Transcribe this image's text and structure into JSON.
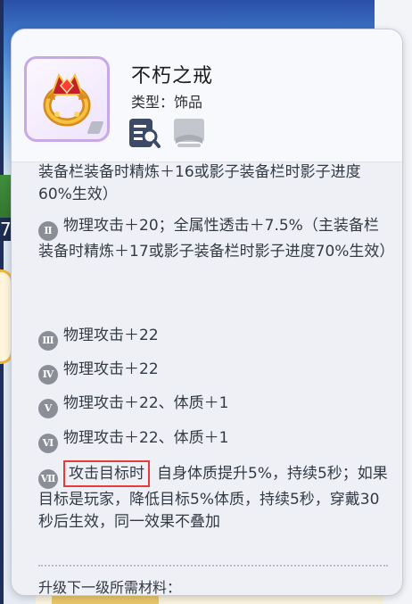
{
  "item": {
    "name": "不朽之戒",
    "type_label": "类型：饰品",
    "rarity_color": "#c7a9e8"
  },
  "actions": {
    "inspect_icon": "inspect-list-icon",
    "book_icon": "book-icon"
  },
  "attributes": [
    {
      "text": "装备栏装备时精炼＋16或影子装备栏时影子进度60%生效）"
    },
    {
      "numeral": "Ⅱ",
      "text": "物理攻击＋20；全属性透击＋7.5%（主装备栏装备时精炼＋17或影子装备栏时影子进度70%生效）"
    },
    {
      "numeral": "Ⅲ",
      "text": "物理攻击＋22"
    },
    {
      "numeral": "Ⅳ",
      "text": "物理攻击＋22"
    },
    {
      "numeral": "Ⅴ",
      "text": "物理攻击＋22、体质＋1"
    },
    {
      "numeral": "Ⅵ",
      "text": "物理攻击＋22、体质＋1"
    },
    {
      "numeral": "Ⅶ",
      "highlight": "攻击目标时",
      "text": "自身体质提升5%，持续5秒；如果目标是玩家，降低目标5%体质，持续5秒，穿戴30秒后生效，同一效果不叠加"
    }
  ],
  "upgrade_label": "升级下一级所需材料："
}
